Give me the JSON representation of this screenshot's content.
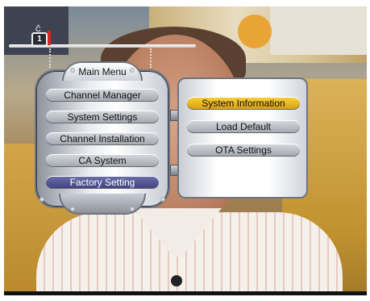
{
  "channel_indicator": {
    "number": "1",
    "top_mark": "Č"
  },
  "main_menu": {
    "title": "Main Menu",
    "items": [
      {
        "label": "Channel Manager"
      },
      {
        "label": "System Settings"
      },
      {
        "label": "Channel Installation"
      },
      {
        "label": "CA System"
      },
      {
        "label": "Factory Setting",
        "selected": true
      }
    ]
  },
  "sub_menu": {
    "items": [
      {
        "label": "System Information",
        "highlighted": true
      },
      {
        "label": "Load Default"
      },
      {
        "label": "OTA Settings"
      }
    ]
  },
  "colors": {
    "selected_main": "#4a4c8c",
    "highlight_sub": "#f2c21f",
    "item_gray": "#b7bac1"
  }
}
